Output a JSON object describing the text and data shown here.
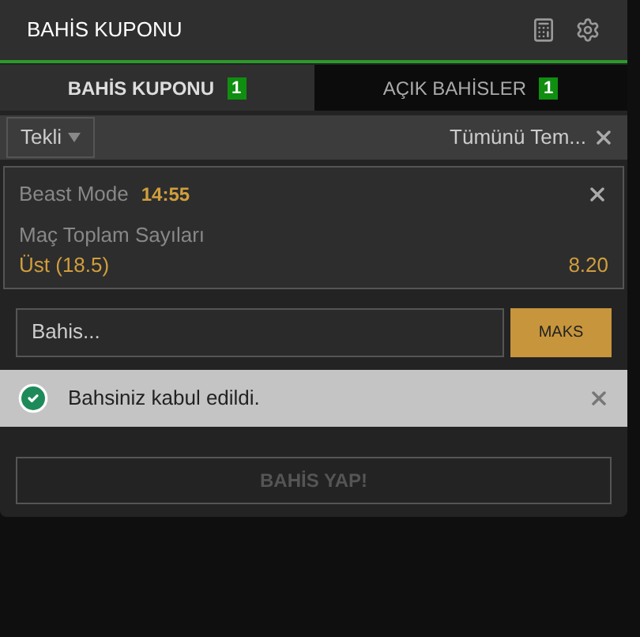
{
  "header": {
    "title": "BAHİS KUPONU"
  },
  "tabs": [
    {
      "label": "BAHİS KUPONU",
      "count": "1",
      "selected": true
    },
    {
      "label": "AÇIK BAHİSLER",
      "count": "1",
      "selected": false
    }
  ],
  "filter": {
    "type_select": "Tekli",
    "clear_all": "Tümünü Tem..."
  },
  "selection": {
    "event": "Beast Mode",
    "time": "14:55",
    "market": "Maç Toplam Sayıları",
    "outcome": "Üst (18.5)",
    "odds": "8.20"
  },
  "stake": {
    "placeholder": "Bahis...",
    "max_button": "MAKS"
  },
  "alert": {
    "kind": "success",
    "message": "Bahsiniz kabul edildi."
  },
  "place_bet": {
    "label": "BAHİS YAP!",
    "disabled": true
  }
}
